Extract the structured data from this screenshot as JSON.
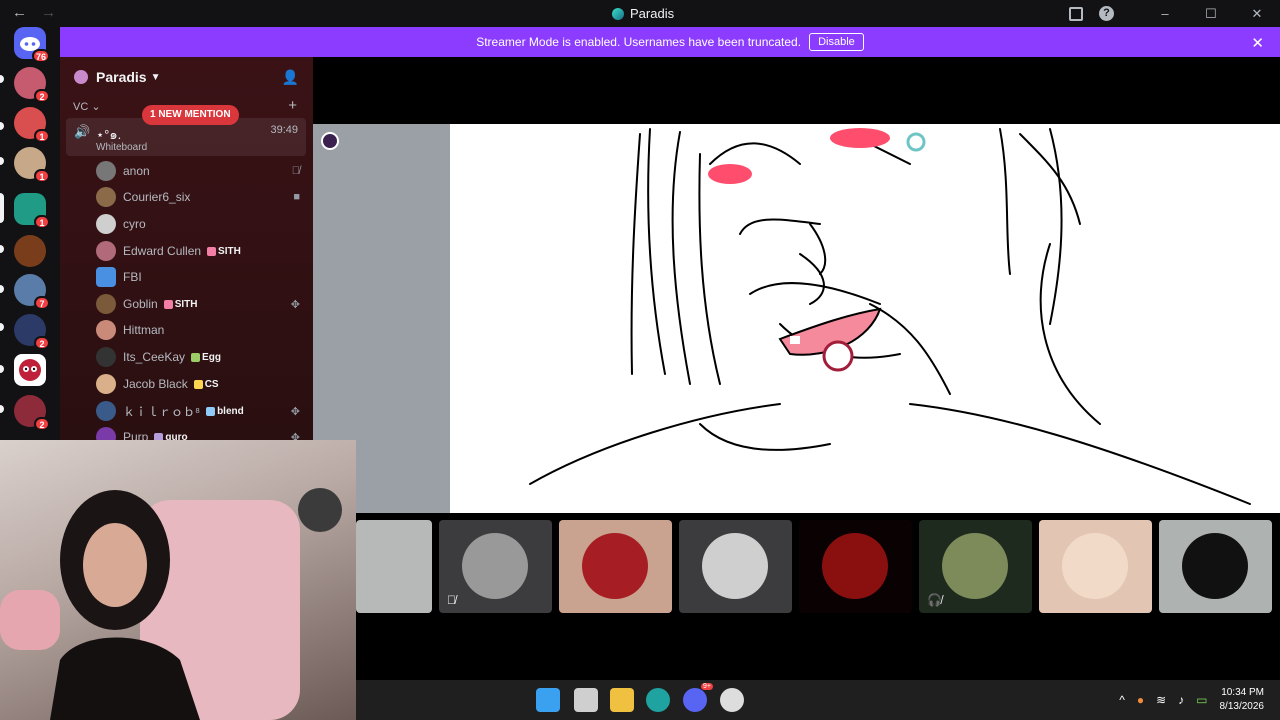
{
  "titlebar": {
    "title": "Paradis",
    "back": "←",
    "forward": "→",
    "min": "–",
    "max": "☐",
    "close": "✕",
    "help": "?"
  },
  "banner": {
    "message": "Streamer Mode is enabled. Usernames have been truncated.",
    "button": "Disable",
    "close": "✕"
  },
  "servers": {
    "home_badge": "76",
    "items": [
      {
        "badge": "2",
        "color": "#c65a6e"
      },
      {
        "badge": "1",
        "color": "#d94f4f"
      },
      {
        "badge": "1",
        "color": "#c7a98a"
      },
      {
        "badge": "1",
        "color": "#1f9b86"
      },
      {
        "badge": "",
        "color": "#7a3d1c"
      },
      {
        "badge": "7",
        "color": "#5a7ca8"
      },
      {
        "badge": "2",
        "color": "#2b3a66"
      },
      {
        "badge": "",
        "color": "#ffffff"
      },
      {
        "badge": "2",
        "color": "#8e2b3a"
      }
    ]
  },
  "sidebar": {
    "guild_name": "Paradis",
    "category": "VC ⌄",
    "mention_pill": "1 NEW MENTION",
    "voice_channel": {
      "name": "⋆°๑.",
      "time": "39:49",
      "activity": "Whiteboard"
    },
    "members": [
      {
        "name": "anon",
        "tag": "",
        "status": "mute",
        "color": "#777"
      },
      {
        "name": "Courier6_six",
        "tag": "",
        "status": "video",
        "color": "#8b6a4a"
      },
      {
        "name": "cyro",
        "tag": "",
        "status": "",
        "color": "#cfcfcf"
      },
      {
        "name": "Edward Cullen",
        "tag": "SITH",
        "status": "",
        "color": "#b06a7a"
      },
      {
        "name": "FBI",
        "tag": "",
        "status": "",
        "color": "#4a90e2"
      },
      {
        "name": "Goblin",
        "tag": "SITH",
        "status": "activity",
        "color": "#7a5a3a"
      },
      {
        "name": "Hittman",
        "tag": "",
        "status": "",
        "color": "#c98a7a"
      },
      {
        "name": "Its_CeeKay",
        "tag": "Egg",
        "status": "",
        "color": "#333"
      },
      {
        "name": "Jacob Black",
        "tag": "CS",
        "status": "",
        "color": "#d9b08a"
      },
      {
        "name": "ｋｉｌｒｏｂ⁸",
        "tag": "blend",
        "status": "activity",
        "color": "#3a5a8a"
      },
      {
        "name": "Purp",
        "tag": "guro",
        "status": "activity",
        "color": "#7a3aa8"
      }
    ]
  },
  "taskbar": {
    "time": "10:34 PM",
    "date": "8/13/2026",
    "discord_badge": "9+"
  }
}
